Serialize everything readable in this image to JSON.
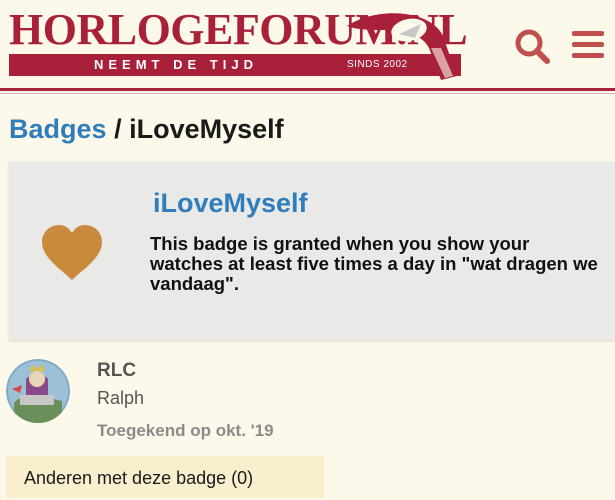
{
  "header": {
    "logo_title": "HORLOGEFORUM.NL",
    "logo_tagline": "NEEMT DE TIJD",
    "logo_since": "SINDS 2002",
    "search_icon": "search-icon",
    "menu_icon": "hamburger-menu-icon"
  },
  "breadcrumb": {
    "parent": "Badges",
    "separator": "/",
    "current": "iLoveMyself"
  },
  "badge": {
    "name": "iLoveMyself",
    "icon": "heart-icon",
    "icon_color": "#c98a3e",
    "description": "This badge is granted when you show your watches at least five times a day in \"wat dragen we vandaag\"."
  },
  "grant": {
    "username": "RLC",
    "full_name": "Ralph",
    "granted_text": "Toegekend op okt. '19"
  },
  "others": {
    "label": "Anderen met deze badge (0)"
  },
  "colors": {
    "brand": "#a8203a",
    "link": "#2f7dbb",
    "background": "#fdf9ea",
    "card": "#e9e9e8"
  }
}
